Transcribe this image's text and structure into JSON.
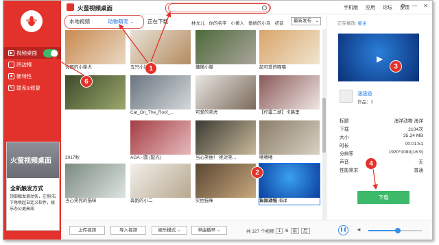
{
  "app": {
    "title": "火萤视频桌面"
  },
  "topnav": [
    "手机版",
    "应用",
    "论坛",
    "反馈"
  ],
  "sidebar": {
    "items": [
      {
        "label": "视频桌面",
        "icon": "video-icon"
      },
      {
        "label": "四边框",
        "icon": "frame-icon"
      },
      {
        "label": "新特性",
        "icon": "star-icon"
      },
      {
        "label": "联系&修复",
        "icon": "wrench-icon"
      }
    ],
    "toggle_on": true,
    "promo": {
      "banner": "火萤视频桌面",
      "title": "全新触发方式",
      "desc": "顶部触发滚动条，左侧/右下角唤起自定义软件，娱乐办公更高效"
    }
  },
  "tabs": {
    "local": "本地视频",
    "category": "动物萌宠",
    "downloading": "正在下载"
  },
  "tags": [
    "林允儿",
    "你的名字",
    "小黄人",
    "傲娇的小鸟",
    "初音"
  ],
  "sort": "最新发布",
  "grid": [
    {
      "caption": "忧郁的小柴犬",
      "c1": "#c98a4f",
      "c2": "#e9d8c4"
    },
    {
      "caption": "五只小狗",
      "c1": "#e8e2d8",
      "c2": "#b58b5e"
    },
    {
      "caption": "慵懒小猫",
      "c1": "#4d6b3a",
      "c2": "#a9a49a"
    },
    {
      "caption": "超可爱的喵喵",
      "c1": "#d9a56a",
      "c2": "#f0e4cf"
    },
    {
      "caption": "",
      "c1": "#3e4a2a",
      "c2": "#9aa86c"
    },
    {
      "caption": "Cat_On_The_Roof_...",
      "c1": "#6a7580",
      "c2": "#d4d8da"
    },
    {
      "caption": "可爱的老虎",
      "c1": "#e8e6e2",
      "c2": "#7b6a5b"
    },
    {
      "caption": "【柠露二胡】卡路里",
      "c1": "#8a5a5a",
      "c2": "#efe6e2"
    },
    {
      "caption": "2017秋",
      "c1": "",
      "c2": ""
    },
    {
      "caption": "AGA - 圆 (配光)",
      "c1": "#a33e43",
      "c2": "#e6b8bb"
    },
    {
      "caption": "当心笑抽！ 绝对笑...",
      "c1": "#3a3a33",
      "c2": "#c9b99a"
    },
    {
      "caption": "嘻嘻嘻",
      "c1": "#8a7d68",
      "c2": "#d8d0c2"
    },
    {
      "caption": "当心笑死的猫咪",
      "c1": "#7b8a80",
      "c2": "#dde5e0"
    },
    {
      "caption": "奔跑的小二",
      "c1": "#f2efe9",
      "c2": "#b7a890"
    },
    {
      "caption": "实拍猫咪",
      "c1": "#5a4733",
      "c2": "#c9a87d"
    },
    {
      "caption": "狗狗滑板",
      "c1": "#4a4a45",
      "c2": "#c8c3b6"
    },
    {
      "caption": "海洋动物 海洋",
      "c1": "#0b3f9e",
      "c2": "#3aa0f0"
    }
  ],
  "bottom": {
    "upload": "上传视频",
    "import": "导入视频",
    "mode": "娱乐模式",
    "loop": "单曲循环",
    "pager": {
      "total": "共 327 个视频",
      "page": "1",
      "pages": "/6",
      "prev": "前",
      "next": "后"
    },
    "volume": 0.55
  },
  "right": {
    "nowplaying_label": "正在播放:",
    "nowplaying_name": "星尘",
    "author_name": "涵涵涵",
    "author_works": "作品：2",
    "info": [
      {
        "k": "标题",
        "v": "海洋动物 海洋"
      },
      {
        "k": "下载",
        "v": "2104次"
      },
      {
        "k": "大小",
        "v": "35.24 MB"
      },
      {
        "k": "时长",
        "v": "00:01:51"
      },
      {
        "k": "分辨率",
        "v": "1920*1080(16:9)"
      },
      {
        "k": "声音",
        "v": "无"
      },
      {
        "k": "性能需求",
        "v": "普通"
      }
    ],
    "download": "下载"
  },
  "annotations": [
    "1",
    "2",
    "3",
    "4",
    "6"
  ],
  "colors": {
    "brand": "#e3322b",
    "accent": "#1a73e8",
    "green": "#3cba6a"
  }
}
